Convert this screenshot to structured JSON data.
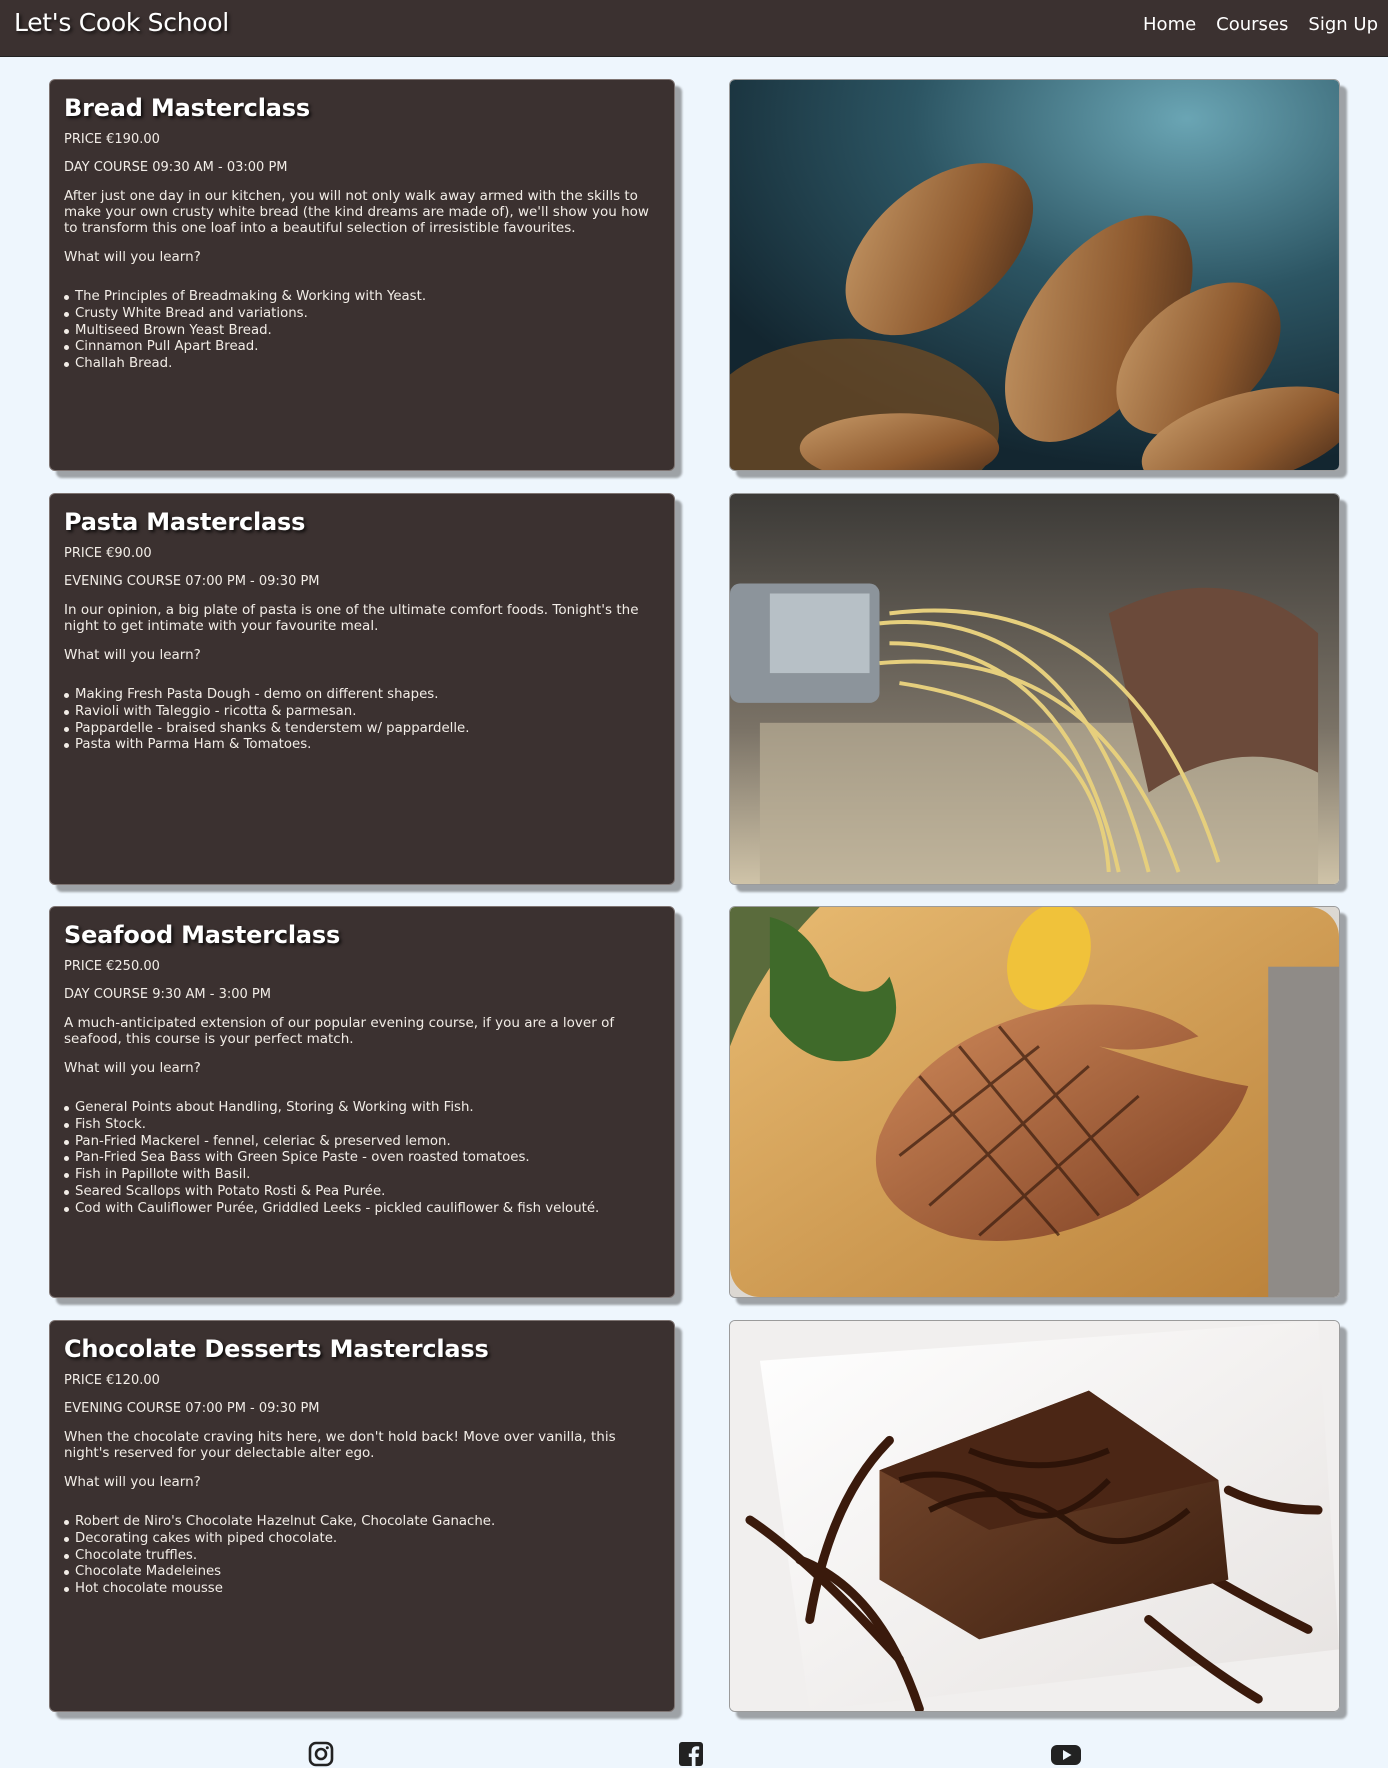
{
  "nav": {
    "brand": "Let's Cook School",
    "links": [
      "Home",
      "Courses",
      "Sign Up"
    ]
  },
  "courses": [
    {
      "title": "Bread Masterclass",
      "price": "PRICE €190.00",
      "schedule": "DAY COURSE 09:30 AM - 03:00 PM",
      "description": "After just one day in our kitchen, you will not only walk away armed with the skills to make your own crusty white bread (the kind dreams are made of), we'll show you how to transform this one loaf into a beautiful selection of irresistible favourites.",
      "learn_heading": "What will you learn?",
      "items": [
        "The Principles of Breadmaking & Working with Yeast.",
        "Crusty White Bread and variations.",
        "Multiseed Brown Yeast Bread.",
        "Cinnamon Pull Apart Bread.",
        "Challah Bread."
      ]
    },
    {
      "title": "Pasta Masterclass",
      "price": "PRICE €90.00",
      "schedule": "EVENING COURSE 07:00 PM - 09:30 PM",
      "description": "In our opinion, a big plate of pasta is one of the ultimate comfort foods. Tonight's the night to get intimate with your favourite meal.",
      "learn_heading": "What will you learn?",
      "items": [
        "Making Fresh Pasta Dough - demo on different shapes.",
        "Ravioli with Taleggio - ricotta & parmesan.",
        "Pappardelle - braised shanks & tenderstem w/ pappardelle.",
        "Pasta with Parma Ham & Tomatoes."
      ]
    },
    {
      "title": "Seafood Masterclass",
      "price": "PRICE €250.00",
      "schedule": "DAY COURSE 9:30 AM - 3:00 PM",
      "description": "A much-anticipated extension of our popular evening course, if you are a lover of seafood, this course is your perfect match.",
      "learn_heading": "What will you learn?",
      "items": [
        "General Points about Handling, Storing & Working with Fish.",
        "Fish Stock.",
        "Pan-Fried Mackerel - fennel, celeriac & preserved lemon.",
        "Pan-Fried Sea Bass with Green Spice Paste - oven roasted tomatoes.",
        "Fish in Papillote with Basil.",
        "Seared Scallops with Potato Rosti & Pea Purée.",
        "Cod with Cauliflower Purée, Griddled Leeks - pickled cauliflower & fish velouté."
      ]
    },
    {
      "title": "Chocolate Desserts Masterclass",
      "price": "PRICE €120.00",
      "schedule": "EVENING COURSE 07:00 PM - 09:30 PM",
      "description": "When the chocolate craving hits here, we don't hold back! Move over vanilla, this night's reserved for your delectable alter ego.",
      "learn_heading": "What will you learn?",
      "items": [
        "Robert de Niro's Chocolate Hazelnut Cake, Chocolate Ganache.",
        "Decorating cakes with piped chocolate.",
        "Chocolate truffles.",
        "Chocolate Madeleines",
        "Hot chocolate mousse"
      ]
    }
  ],
  "footer": {
    "icons": [
      "instagram-icon",
      "facebook-icon",
      "youtube-icon"
    ]
  },
  "colors": {
    "header_bg": "#3b3130",
    "card_bg": "#3b3130",
    "page_bg": "#eef6fd"
  }
}
